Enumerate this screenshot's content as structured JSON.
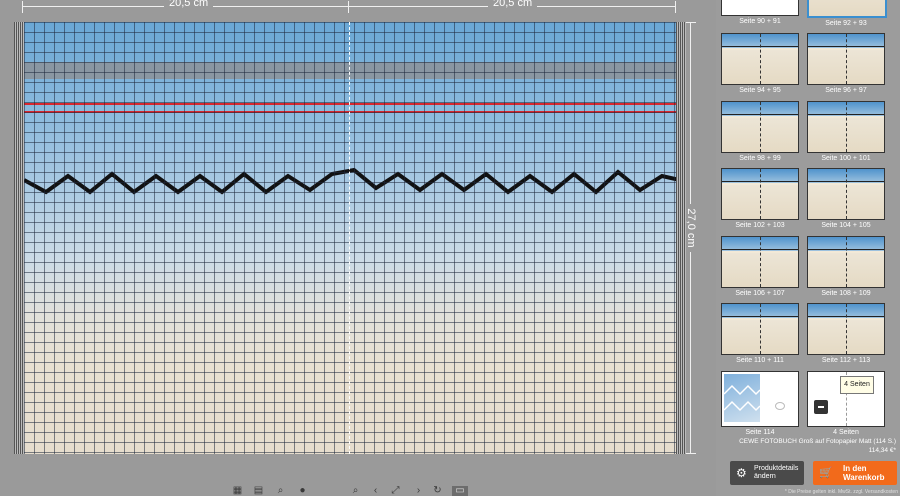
{
  "ruler": {
    "left_width": "20,5 cm",
    "right_width": "20,5 cm",
    "height": "27,0 cm"
  },
  "sidebar": {
    "thumbnails": [
      {
        "label": "Seite 90 + 91",
        "selected": false
      },
      {
        "label": "Seite 92 + 93",
        "selected": true
      },
      {
        "label": "Seite 94 + 95",
        "selected": false
      },
      {
        "label": "Seite 96 + 97",
        "selected": false
      },
      {
        "label": "Seite 98 + 99",
        "selected": false
      },
      {
        "label": "Seite 100 + 101",
        "selected": false
      },
      {
        "label": "Seite 102 + 103",
        "selected": false
      },
      {
        "label": "Seite 104 + 105",
        "selected": false
      },
      {
        "label": "Seite 106 + 107",
        "selected": false
      },
      {
        "label": "Seite 108 + 109",
        "selected": false
      },
      {
        "label": "Seite 110 + 111",
        "selected": false
      },
      {
        "label": "Seite 112 + 113",
        "selected": false
      },
      {
        "label": "Seite 114",
        "selected": false
      },
      {
        "label": "4 Seiten",
        "selected": false
      }
    ],
    "tooltip": "4 Seiten",
    "product": {
      "name": "CEWE FOTOBUCH Groß auf Fotopapier Matt (114 S.)",
      "price": "114,34 €*"
    },
    "buttons": {
      "details": "Produktdetails ändern",
      "cart": "In den Warenkorb"
    },
    "footnote": "* Die Preise gelten inkl. MwSt. zzgl. Versandkosten"
  },
  "colors": {
    "cart_button": "#f26a1b",
    "selection": "#3a8fd0",
    "guide_lines": "#d9262e"
  },
  "icons": [
    "grid-view-icon",
    "layout-icon",
    "zoom-out-icon",
    "slider-knob-icon",
    "zoom-in-icon",
    "undo-icon",
    "fit-icon",
    "fullscreen-icon",
    "redo-icon",
    "preview-icon"
  ]
}
